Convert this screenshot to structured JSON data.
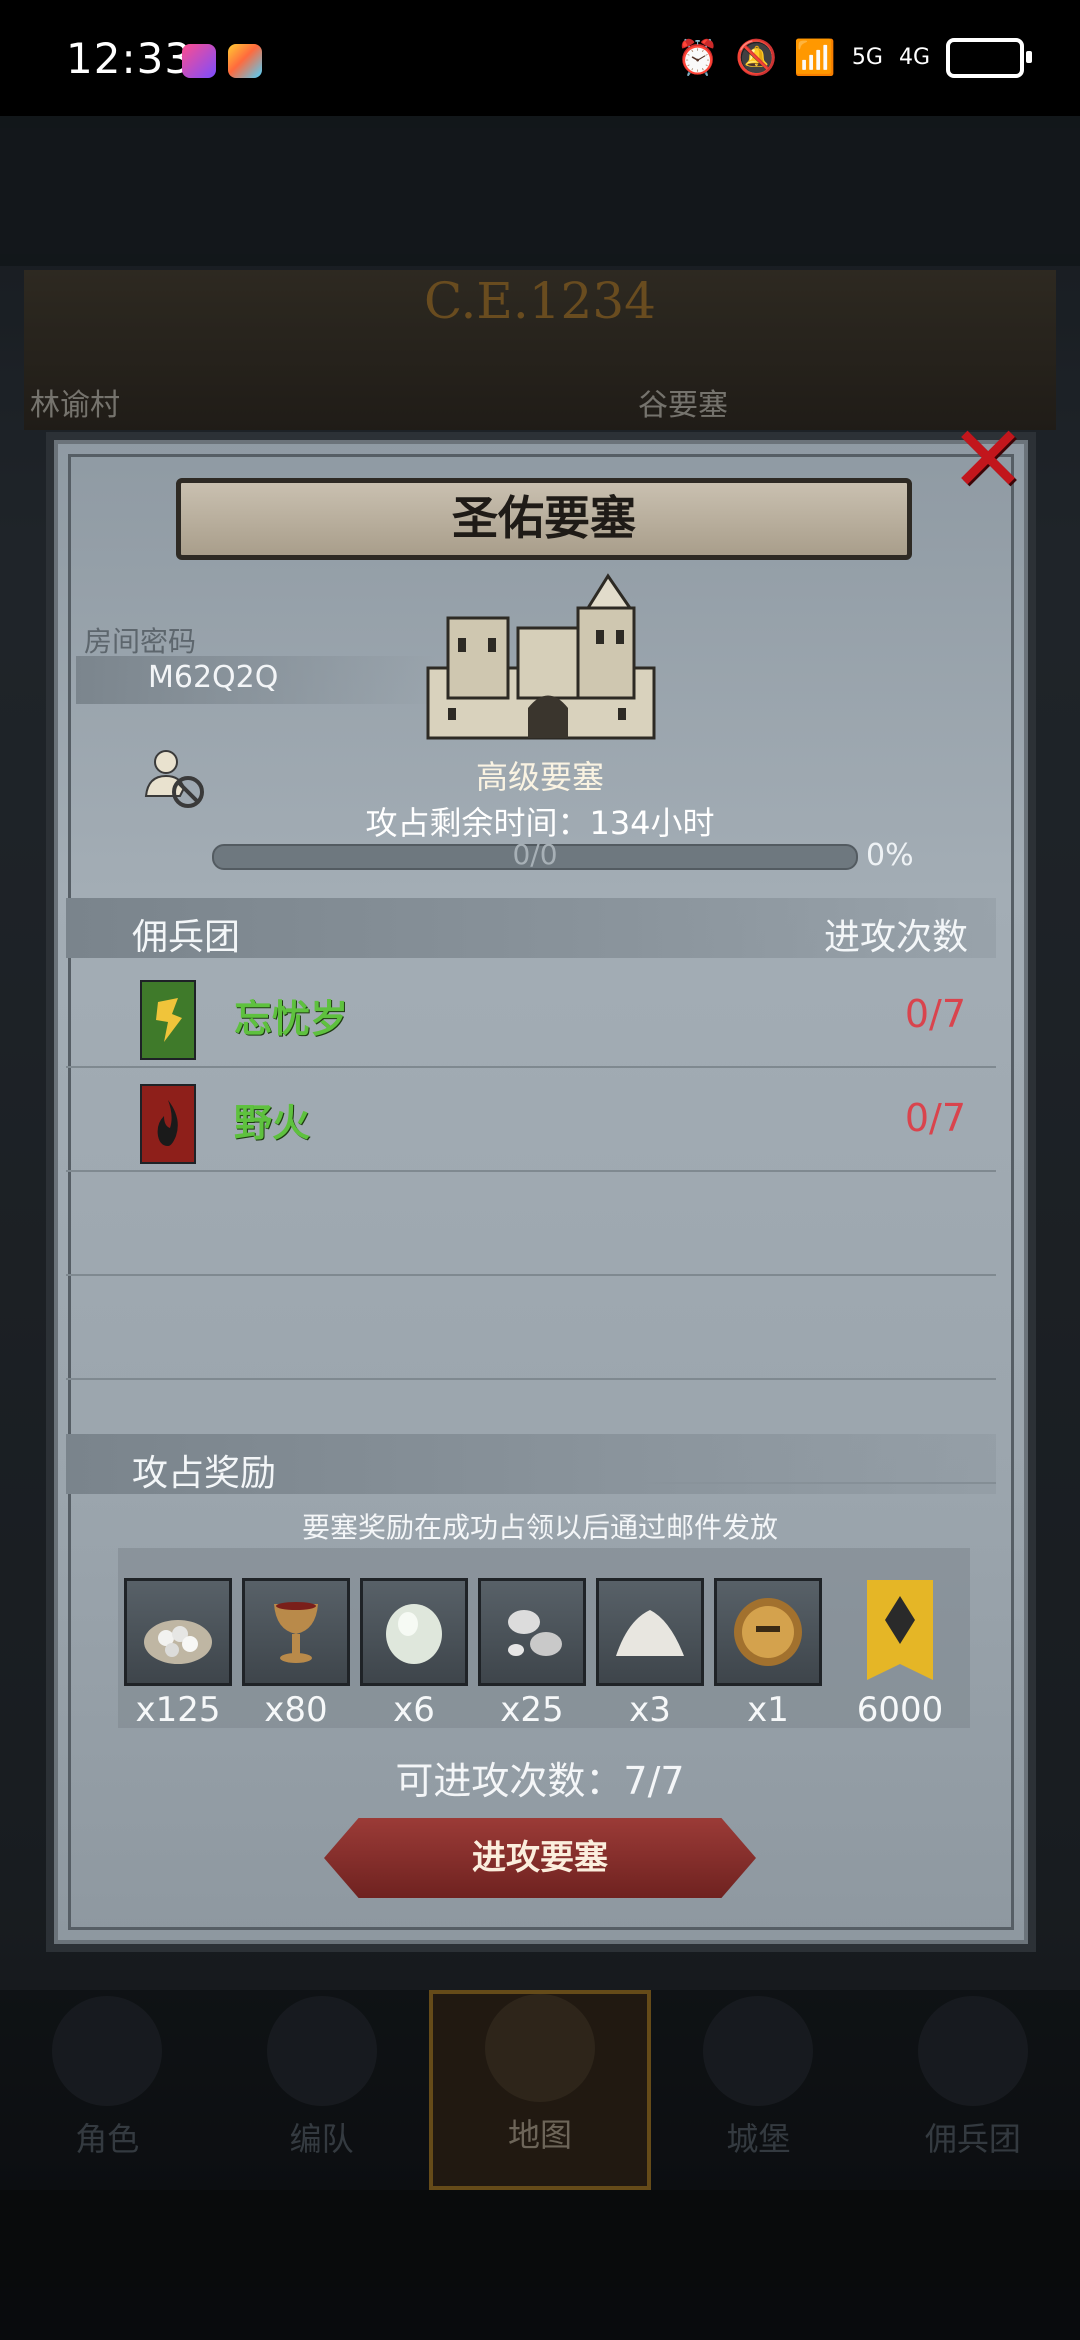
{
  "status_bar": {
    "time": "12:33",
    "network1": "5G",
    "network2": "4G"
  },
  "background": {
    "era": "C.E.1234",
    "map_left_label": "林谕村",
    "map_right_label": "谷要塞"
  },
  "dialog": {
    "title": "圣佑要塞",
    "close_icon": "close-x-icon",
    "room_code_label": "房间密码",
    "room_code": "M62Q2Q",
    "fort_level": "高级要塞",
    "time_left_label": "攻占剩余时间：",
    "time_left_value": "134小时",
    "progress": {
      "text": "0/0",
      "percent_label": "0%",
      "fraction": 0
    },
    "mercenary_header": "佣兵团",
    "attack_times_header": "进攻次数",
    "mercenaries": [
      {
        "name": "忘忧岁",
        "count": "0/7",
        "flag_color": "#3f7a2a"
      },
      {
        "name": "野火",
        "count": "0/7",
        "flag_color": "#8e1f1a"
      }
    ],
    "rewards_header": "攻占奖励",
    "rewards_note": "要塞奖励在成功占领以后通过邮件发放",
    "rewards": [
      {
        "icon": "silver-coins-bag-icon",
        "qty": "x125"
      },
      {
        "icon": "goblet-icon",
        "qty": "x80"
      },
      {
        "icon": "gem-stone-icon",
        "qty": "x6"
      },
      {
        "icon": "silver-ore-icon",
        "qty": "x25"
      },
      {
        "icon": "salt-pile-icon",
        "qty": "x3"
      },
      {
        "icon": "knight-helmet-medal-icon",
        "qty": "x1"
      },
      {
        "icon": "guild-banner-icon",
        "qty": "6000"
      }
    ],
    "attack_count_label": "可进攻次数：7/7",
    "attack_button": "进攻要塞"
  },
  "bottom_nav": [
    {
      "label": "角色",
      "active": false
    },
    {
      "label": "编队",
      "active": false
    },
    {
      "label": "地图",
      "active": true
    },
    {
      "label": "城堡",
      "active": false
    },
    {
      "label": "佣兵团",
      "active": false
    }
  ],
  "colors": {
    "accent_green": "#5ec13e",
    "count_red": "#d9444d",
    "close_red": "#c2161c",
    "button_red": "#8e302d"
  }
}
